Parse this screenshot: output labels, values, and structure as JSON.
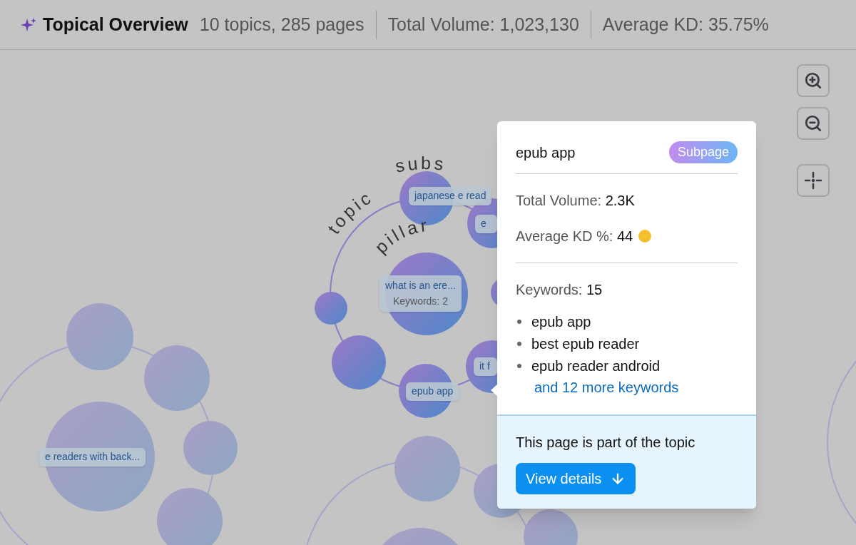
{
  "header": {
    "title": "Topical Overview",
    "summary": "10 topics, 285 pages",
    "total_volume": "Total Volume: 1,023,130",
    "average_kd": "Average KD: 35.75%"
  },
  "canvas": {
    "arc_labels": [
      {
        "text": "topic",
        "kind": "outer_left"
      },
      {
        "text": "subs",
        "kind": "outer_right"
      },
      {
        "text": "pillar",
        "kind": "inner"
      }
    ],
    "node_labels": [
      {
        "text": "japanese e read",
        "kind": "single"
      },
      {
        "text": "e",
        "kind": "single"
      },
      {
        "text": "what is an ere...",
        "keywords": "Keywords: 2",
        "kind": "pillar"
      },
      {
        "text": "it f",
        "kind": "single"
      },
      {
        "text": "epub app",
        "kind": "single"
      },
      {
        "text": "e readers with back...",
        "kind": "single"
      }
    ]
  },
  "popup": {
    "title": "epub app",
    "badge": "Subpage",
    "total_volume_label": "Total Volume:",
    "total_volume": "2.3K",
    "kd_label": "Average KD %:",
    "kd": {
      "value": "44",
      "color": "#f5c02c"
    },
    "keywords_label": "Keywords:",
    "keywords_count": "15",
    "keywords": [
      "epub app",
      "best epub reader",
      "epub reader android"
    ],
    "more_link": "and 12 more keywords",
    "footer_text": "This page is part of the topic",
    "button": "View details"
  }
}
